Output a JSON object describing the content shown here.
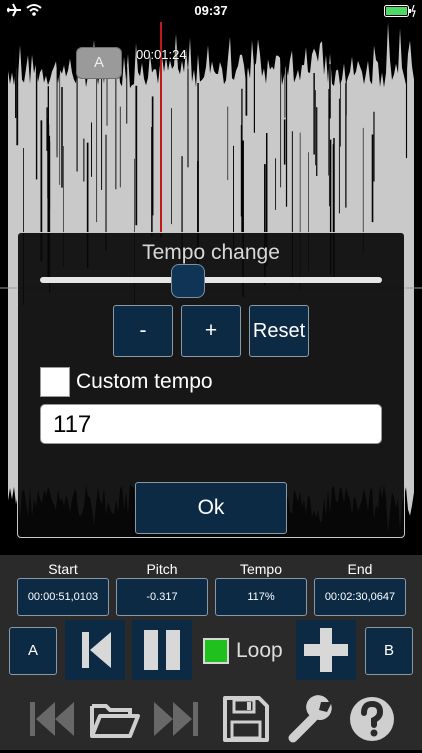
{
  "status": {
    "time": "09:37"
  },
  "waveform": {
    "marker_a": "A",
    "current_time": "00:01:24"
  },
  "dialog": {
    "title": "Tempo change",
    "slider_value_percent": 117,
    "minus_label": "-",
    "plus_label": "+",
    "reset_label": "Reset",
    "custom_label": "Custom tempo",
    "custom_checked": false,
    "tempo_value": "117",
    "ok_label": "Ok"
  },
  "controls": {
    "labels": {
      "start": "Start",
      "pitch": "Pitch",
      "tempo": "Tempo",
      "end": "End"
    },
    "values": {
      "start": "00:00:51,0103",
      "pitch": "-0.317",
      "tempo": "117%",
      "end": "00:02:30,0647"
    },
    "a_label": "A",
    "b_label": "B",
    "loop_label": "Loop",
    "loop_checked": true
  },
  "icons": {
    "status_left": [
      "airplane-icon",
      "wifi-icon"
    ],
    "status_right": [
      "battery-charging-icon"
    ],
    "transport": [
      "skip-back-icon",
      "pause-icon",
      "add-icon"
    ],
    "bottom": [
      "rewind-start-icon",
      "open-folder-icon",
      "fast-forward-end-icon",
      "save-icon",
      "settings-wrench-icon",
      "help-icon"
    ]
  },
  "colors": {
    "accent": "#0d2a45",
    "playhead": "#c0181b",
    "loop_on": "#20c01f",
    "battery": "#4cd964"
  }
}
